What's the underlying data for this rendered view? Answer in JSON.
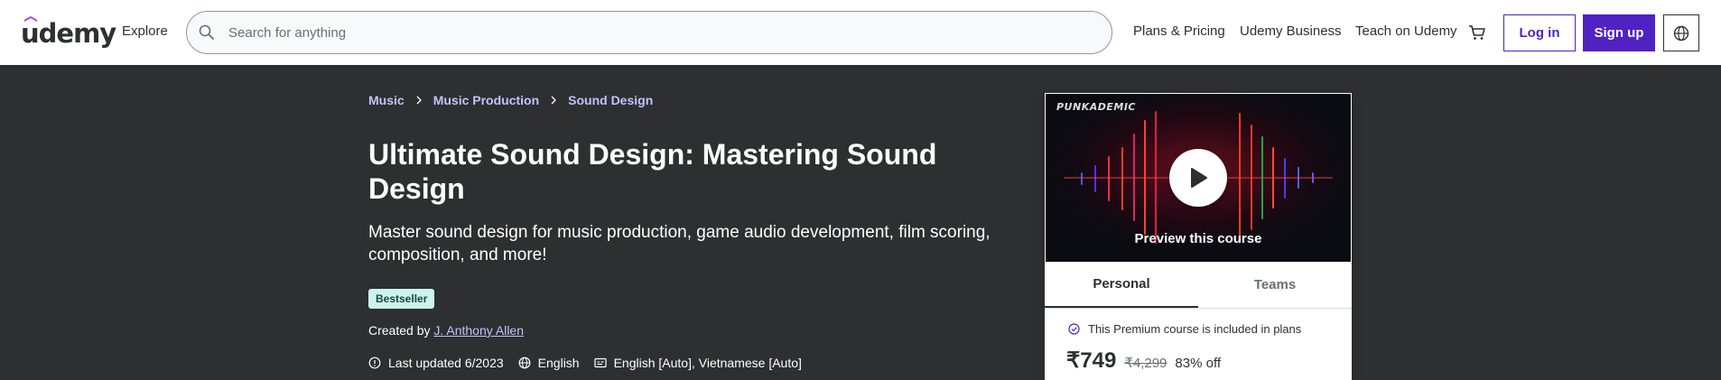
{
  "header": {
    "logo": "udemy",
    "explore": "Explore",
    "search_placeholder": "Search for anything",
    "plans_pricing": "Plans & Pricing",
    "udemy_business": "Udemy Business",
    "teach": "Teach on Udemy",
    "login": "Log in",
    "signup": "Sign up"
  },
  "breadcrumbs": [
    "Music",
    "Music Production",
    "Sound Design"
  ],
  "course": {
    "title": "Ultimate Sound Design: Mastering Sound Design",
    "subtitle": "Master sound design for music production, game audio development, film scoring, composition, and more!",
    "badge": "Bestseller",
    "created_by_label": "Created by",
    "instructor": "J. Anthony Allen",
    "last_updated": "Last updated 6/2023",
    "language": "English",
    "captions": "English [Auto], Vietnamese [Auto]"
  },
  "card": {
    "preview_brand": "PUNKADEMIC",
    "preview_label": "Preview this course",
    "tabs": [
      "Personal",
      "Teams"
    ],
    "premium_note": "This Premium course is included in plans",
    "price": "₹749",
    "original_price": "₹4,299",
    "discount": "83% off"
  },
  "colors": {
    "brand_purple": "#5022c3",
    "hero_bg": "#2d2f31",
    "crumb_link": "#c0c4fc",
    "badge_bg": "#cef2ec"
  }
}
